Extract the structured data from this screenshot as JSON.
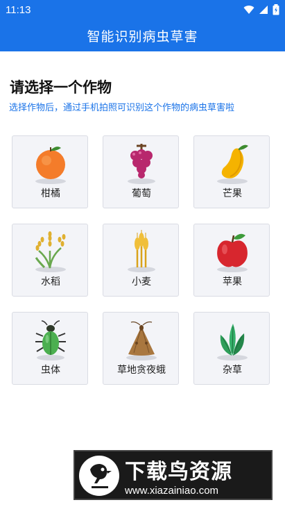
{
  "status_bar": {
    "time": "11:13"
  },
  "app_bar": {
    "title": "智能识别病虫草害"
  },
  "content": {
    "heading": "请选择一个作物",
    "subheading": "选择作物后，通过手机拍照可识别这个作物的病虫草害啦"
  },
  "crops": [
    {
      "label": "柑橘",
      "icon": "orange-icon"
    },
    {
      "label": "葡萄",
      "icon": "grape-icon"
    },
    {
      "label": "芒果",
      "icon": "mango-icon"
    },
    {
      "label": "水稻",
      "icon": "rice-icon"
    },
    {
      "label": "小麦",
      "icon": "wheat-icon"
    },
    {
      "label": "苹果",
      "icon": "apple-icon"
    },
    {
      "label": "虫体",
      "icon": "beetle-icon"
    },
    {
      "label": "草地贪夜蛾",
      "icon": "moth-icon"
    },
    {
      "label": "杂草",
      "icon": "weed-icon"
    }
  ],
  "watermark": {
    "brand": "下载鸟资源",
    "url": "www.xiazainiao.com"
  },
  "colors": {
    "primary": "#1a73e8",
    "card_bg": "#f3f4f8",
    "card_border": "#d9dbe3"
  }
}
